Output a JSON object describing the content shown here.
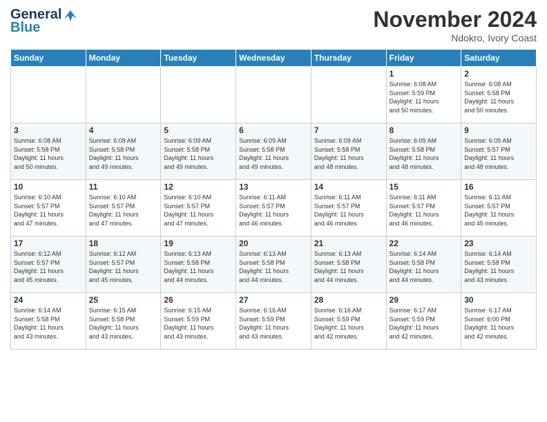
{
  "logo": {
    "line1": "General",
    "line2": "Blue"
  },
  "header": {
    "month": "November 2024",
    "location": "Ndokro, Ivory Coast"
  },
  "weekdays": [
    "Sunday",
    "Monday",
    "Tuesday",
    "Wednesday",
    "Thursday",
    "Friday",
    "Saturday"
  ],
  "weeks": [
    [
      {
        "day": "",
        "info": ""
      },
      {
        "day": "",
        "info": ""
      },
      {
        "day": "",
        "info": ""
      },
      {
        "day": "",
        "info": ""
      },
      {
        "day": "",
        "info": ""
      },
      {
        "day": "1",
        "info": "Sunrise: 6:08 AM\nSunset: 5:59 PM\nDaylight: 11 hours\nand 50 minutes."
      },
      {
        "day": "2",
        "info": "Sunrise: 6:08 AM\nSunset: 5:58 PM\nDaylight: 11 hours\nand 50 minutes."
      }
    ],
    [
      {
        "day": "3",
        "info": "Sunrise: 6:08 AM\nSunset: 5:58 PM\nDaylight: 11 hours\nand 50 minutes."
      },
      {
        "day": "4",
        "info": "Sunrise: 6:08 AM\nSunset: 5:58 PM\nDaylight: 11 hours\nand 49 minutes."
      },
      {
        "day": "5",
        "info": "Sunrise: 6:09 AM\nSunset: 5:58 PM\nDaylight: 11 hours\nand 49 minutes."
      },
      {
        "day": "6",
        "info": "Sunrise: 6:09 AM\nSunset: 5:58 PM\nDaylight: 11 hours\nand 49 minutes."
      },
      {
        "day": "7",
        "info": "Sunrise: 6:09 AM\nSunset: 5:58 PM\nDaylight: 11 hours\nand 48 minutes."
      },
      {
        "day": "8",
        "info": "Sunrise: 6:09 AM\nSunset: 5:58 PM\nDaylight: 11 hours\nand 48 minutes."
      },
      {
        "day": "9",
        "info": "Sunrise: 6:09 AM\nSunset: 5:57 PM\nDaylight: 11 hours\nand 48 minutes."
      }
    ],
    [
      {
        "day": "10",
        "info": "Sunrise: 6:10 AM\nSunset: 5:57 PM\nDaylight: 11 hours\nand 47 minutes."
      },
      {
        "day": "11",
        "info": "Sunrise: 6:10 AM\nSunset: 5:57 PM\nDaylight: 11 hours\nand 47 minutes."
      },
      {
        "day": "12",
        "info": "Sunrise: 6:10 AM\nSunset: 5:57 PM\nDaylight: 11 hours\nand 47 minutes."
      },
      {
        "day": "13",
        "info": "Sunrise: 6:11 AM\nSunset: 5:57 PM\nDaylight: 11 hours\nand 46 minutes."
      },
      {
        "day": "14",
        "info": "Sunrise: 6:11 AM\nSunset: 5:57 PM\nDaylight: 11 hours\nand 46 minutes."
      },
      {
        "day": "15",
        "info": "Sunrise: 6:11 AM\nSunset: 5:57 PM\nDaylight: 11 hours\nand 46 minutes."
      },
      {
        "day": "16",
        "info": "Sunrise: 6:11 AM\nSunset: 5:57 PM\nDaylight: 11 hours\nand 45 minutes."
      }
    ],
    [
      {
        "day": "17",
        "info": "Sunrise: 6:12 AM\nSunset: 5:57 PM\nDaylight: 11 hours\nand 45 minutes."
      },
      {
        "day": "18",
        "info": "Sunrise: 6:12 AM\nSunset: 5:57 PM\nDaylight: 11 hours\nand 45 minutes."
      },
      {
        "day": "19",
        "info": "Sunrise: 6:13 AM\nSunset: 5:58 PM\nDaylight: 11 hours\nand 44 minutes."
      },
      {
        "day": "20",
        "info": "Sunrise: 6:13 AM\nSunset: 5:58 PM\nDaylight: 11 hours\nand 44 minutes."
      },
      {
        "day": "21",
        "info": "Sunrise: 6:13 AM\nSunset: 5:58 PM\nDaylight: 11 hours\nand 44 minutes."
      },
      {
        "day": "22",
        "info": "Sunrise: 6:14 AM\nSunset: 5:58 PM\nDaylight: 11 hours\nand 44 minutes."
      },
      {
        "day": "23",
        "info": "Sunrise: 6:14 AM\nSunset: 5:58 PM\nDaylight: 11 hours\nand 43 minutes."
      }
    ],
    [
      {
        "day": "24",
        "info": "Sunrise: 6:14 AM\nSunset: 5:58 PM\nDaylight: 11 hours\nand 43 minutes."
      },
      {
        "day": "25",
        "info": "Sunrise: 6:15 AM\nSunset: 5:58 PM\nDaylight: 11 hours\nand 43 minutes."
      },
      {
        "day": "26",
        "info": "Sunrise: 6:15 AM\nSunset: 5:59 PM\nDaylight: 11 hours\nand 43 minutes."
      },
      {
        "day": "27",
        "info": "Sunrise: 6:16 AM\nSunset: 5:59 PM\nDaylight: 11 hours\nand 43 minutes."
      },
      {
        "day": "28",
        "info": "Sunrise: 6:16 AM\nSunset: 5:59 PM\nDaylight: 11 hours\nand 42 minutes."
      },
      {
        "day": "29",
        "info": "Sunrise: 6:17 AM\nSunset: 5:59 PM\nDaylight: 11 hours\nand 42 minutes."
      },
      {
        "day": "30",
        "info": "Sunrise: 6:17 AM\nSunset: 6:00 PM\nDaylight: 11 hours\nand 42 minutes."
      }
    ]
  ]
}
